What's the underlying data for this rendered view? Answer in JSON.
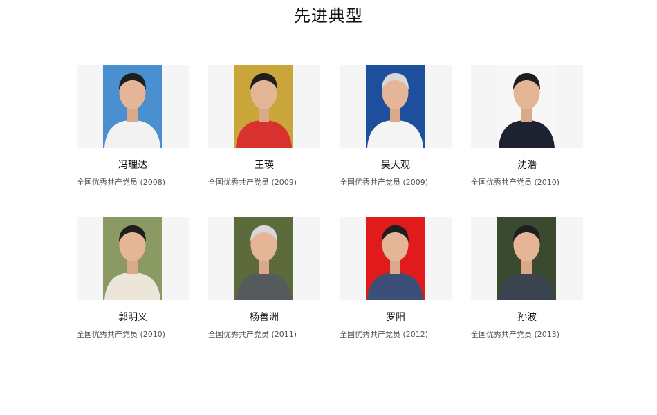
{
  "page": {
    "title": "先进典型"
  },
  "people": [
    {
      "name": "冯理达",
      "honor": "全国优秀共产党员 (2008)",
      "photo_bg": "#4a8fd0",
      "clothing": "#f2f2f2"
    },
    {
      "name": "王瑛",
      "honor": "全国优秀共产党员 (2009)",
      "photo_bg": "#c9a53a",
      "clothing": "#d8322e"
    },
    {
      "name": "吴大观",
      "honor": "全国优秀共产党员 (2009)",
      "photo_bg": "#1d4f9c",
      "clothing": "#f4f4f4"
    },
    {
      "name": "沈浩",
      "honor": "全国优秀共产党员 (2010)",
      "photo_bg": "#f7f7f7",
      "clothing": "#1e2230"
    },
    {
      "name": "郭明义",
      "honor": "全国优秀共产党员 (2010)",
      "photo_bg": "#8a9a62",
      "clothing": "#ece6da"
    },
    {
      "name": "杨善洲",
      "honor": "全国优秀共产党员 (2011)",
      "photo_bg": "#5d6b3c",
      "clothing": "#555a5c"
    },
    {
      "name": "罗阳",
      "honor": "全国优秀共产党员 (2012)",
      "photo_bg": "#e11b1b",
      "clothing": "#3c4f78"
    },
    {
      "name": "孙波",
      "honor": "全国优秀共产党员 (2013)",
      "photo_bg": "#3a4a2e",
      "clothing": "#3a4450"
    }
  ]
}
